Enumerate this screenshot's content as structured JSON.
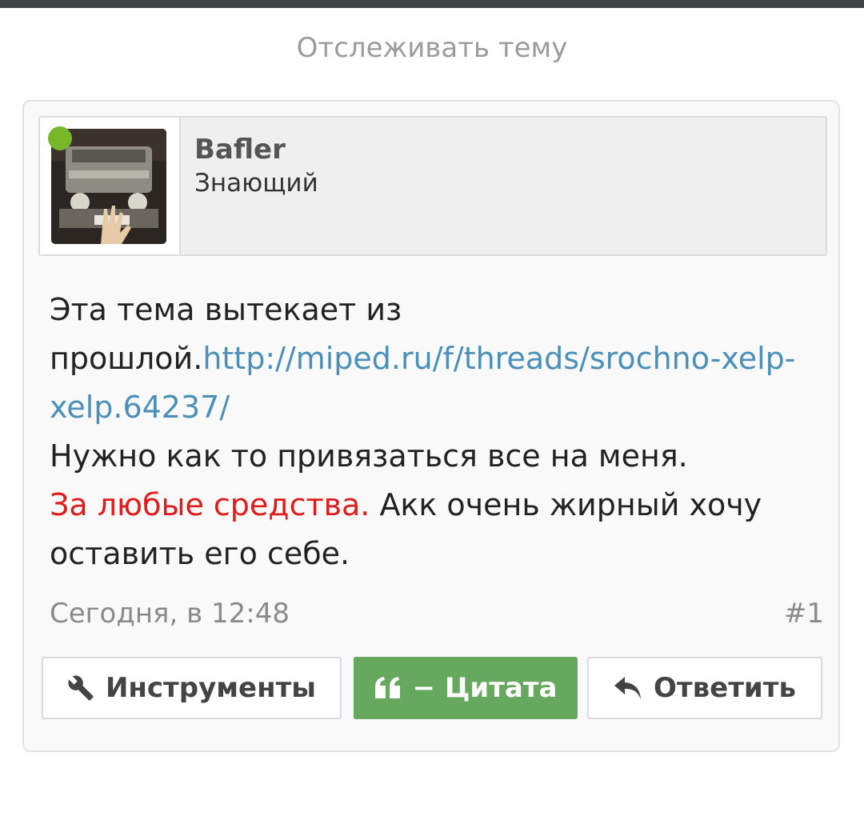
{
  "header": {
    "watch_thread_label": "Отслеживать тему"
  },
  "post": {
    "author": {
      "username": "Bafler",
      "user_title": "Знающий",
      "online": true
    },
    "message": {
      "line1": "Эта тема вытекает из прошлой.",
      "link_text": "http://miped.ru/f/threads/srochno-xelp-xelp.64237/",
      "line2": "Нужно как то привязаться все на меня.",
      "highlight_text": "За любые средства.",
      "line3": " Акк очень жирный хочу оставить его себе."
    },
    "date": "Сегодня, в 12:48",
    "number": "#1",
    "buttons": {
      "tools_label": "Инструменты",
      "quote_label": "− Цитата",
      "reply_label": "Ответить"
    }
  },
  "colors": {
    "link": "#4a90b8",
    "highlight": "#e01b1b",
    "quote_button": "#67a85f",
    "online": "#76b82a"
  }
}
